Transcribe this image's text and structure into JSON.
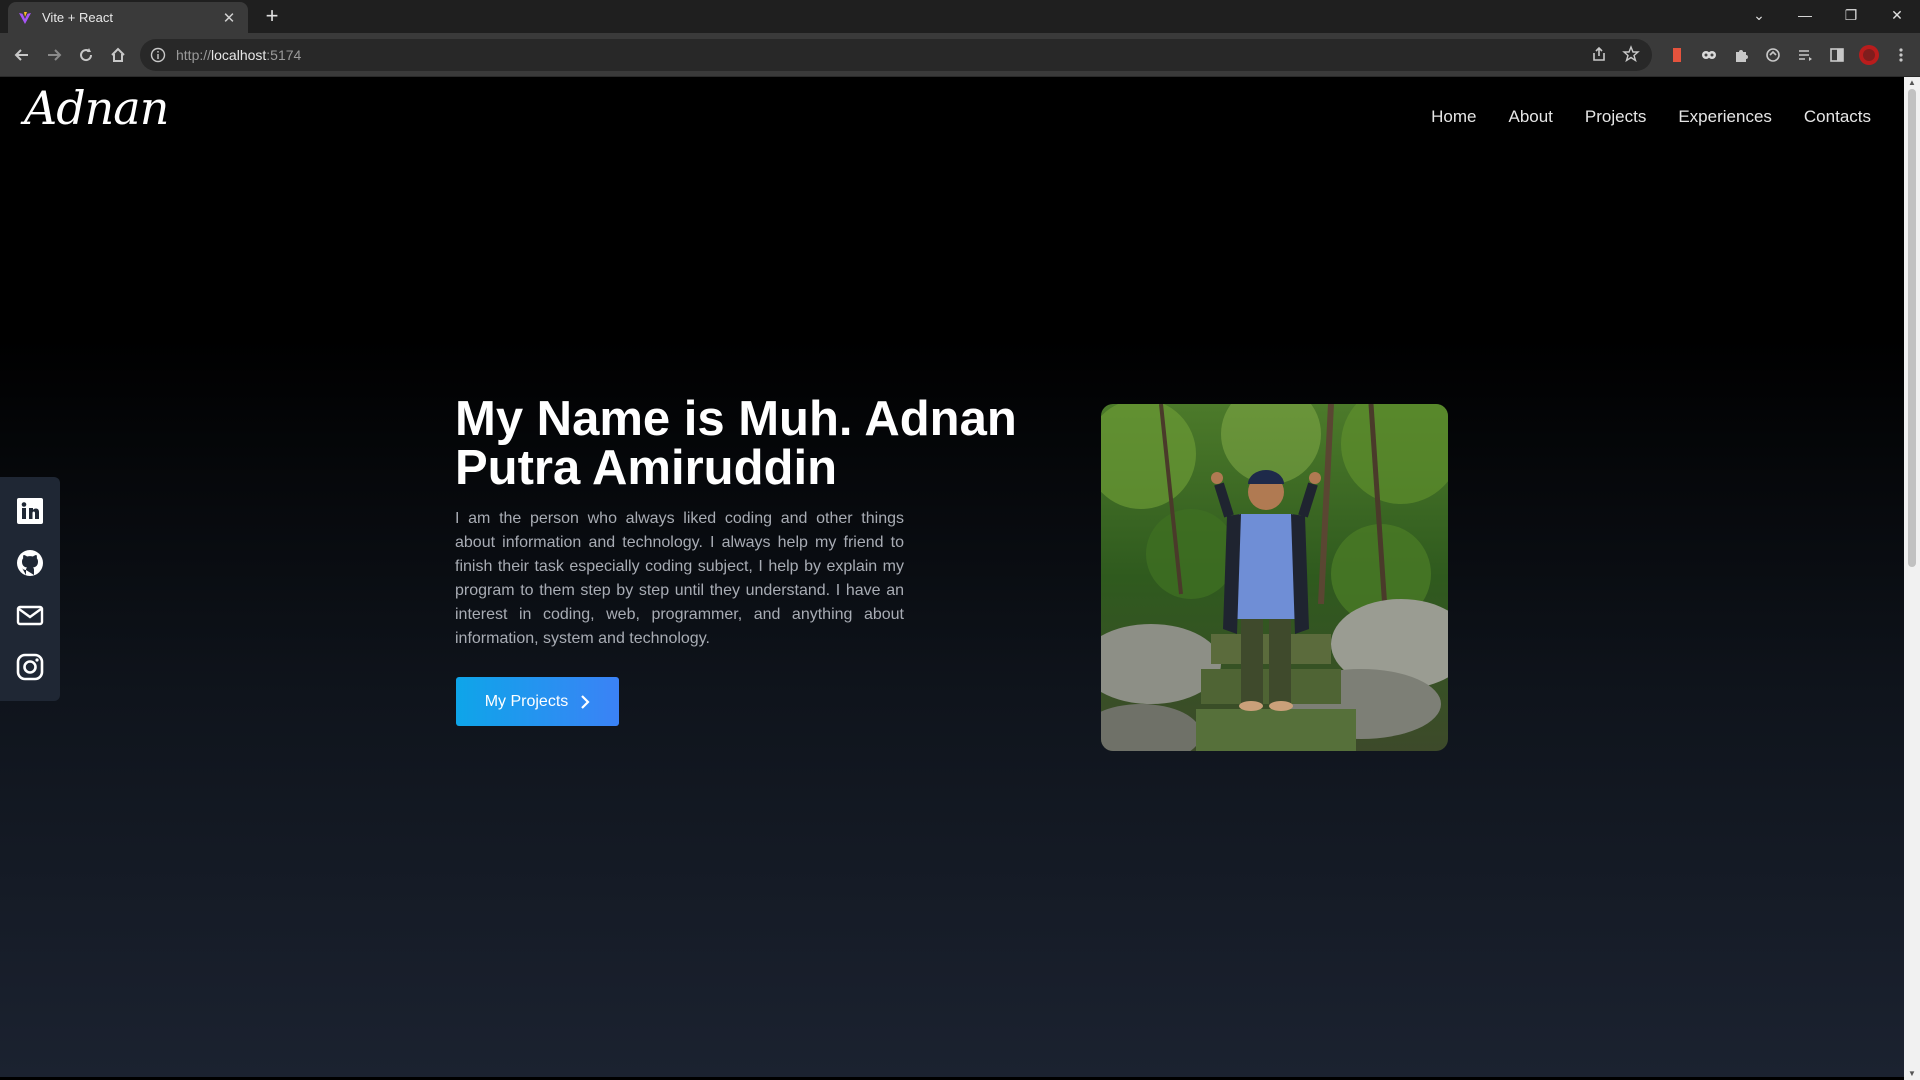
{
  "browser": {
    "tab_title": "Vite + React",
    "url_protocol": "http://",
    "url_host": "localhost",
    "url_port": ":5174"
  },
  "site": {
    "logo": "Adnan",
    "nav": [
      "Home",
      "About",
      "Projects",
      "Experiences",
      "Contacts"
    ]
  },
  "hero": {
    "title": "My Name is Muh. Adnan Putra Amiruddin",
    "description": "I am the person who always liked coding and other things about information and technology. I always help my friend to finish their task especially coding subject, I help by explain my program to them step by step until they understand. I have an interest in coding, web, programmer, and anything about information, system and technology.",
    "cta_label": "My Projects"
  },
  "socials": [
    "linkedin-icon",
    "github-icon",
    "mail-icon",
    "instagram-icon"
  ],
  "colors": {
    "accent_start": "#0ea5e9",
    "accent_end": "#3b82f6",
    "social_bar": "#1f2734"
  }
}
